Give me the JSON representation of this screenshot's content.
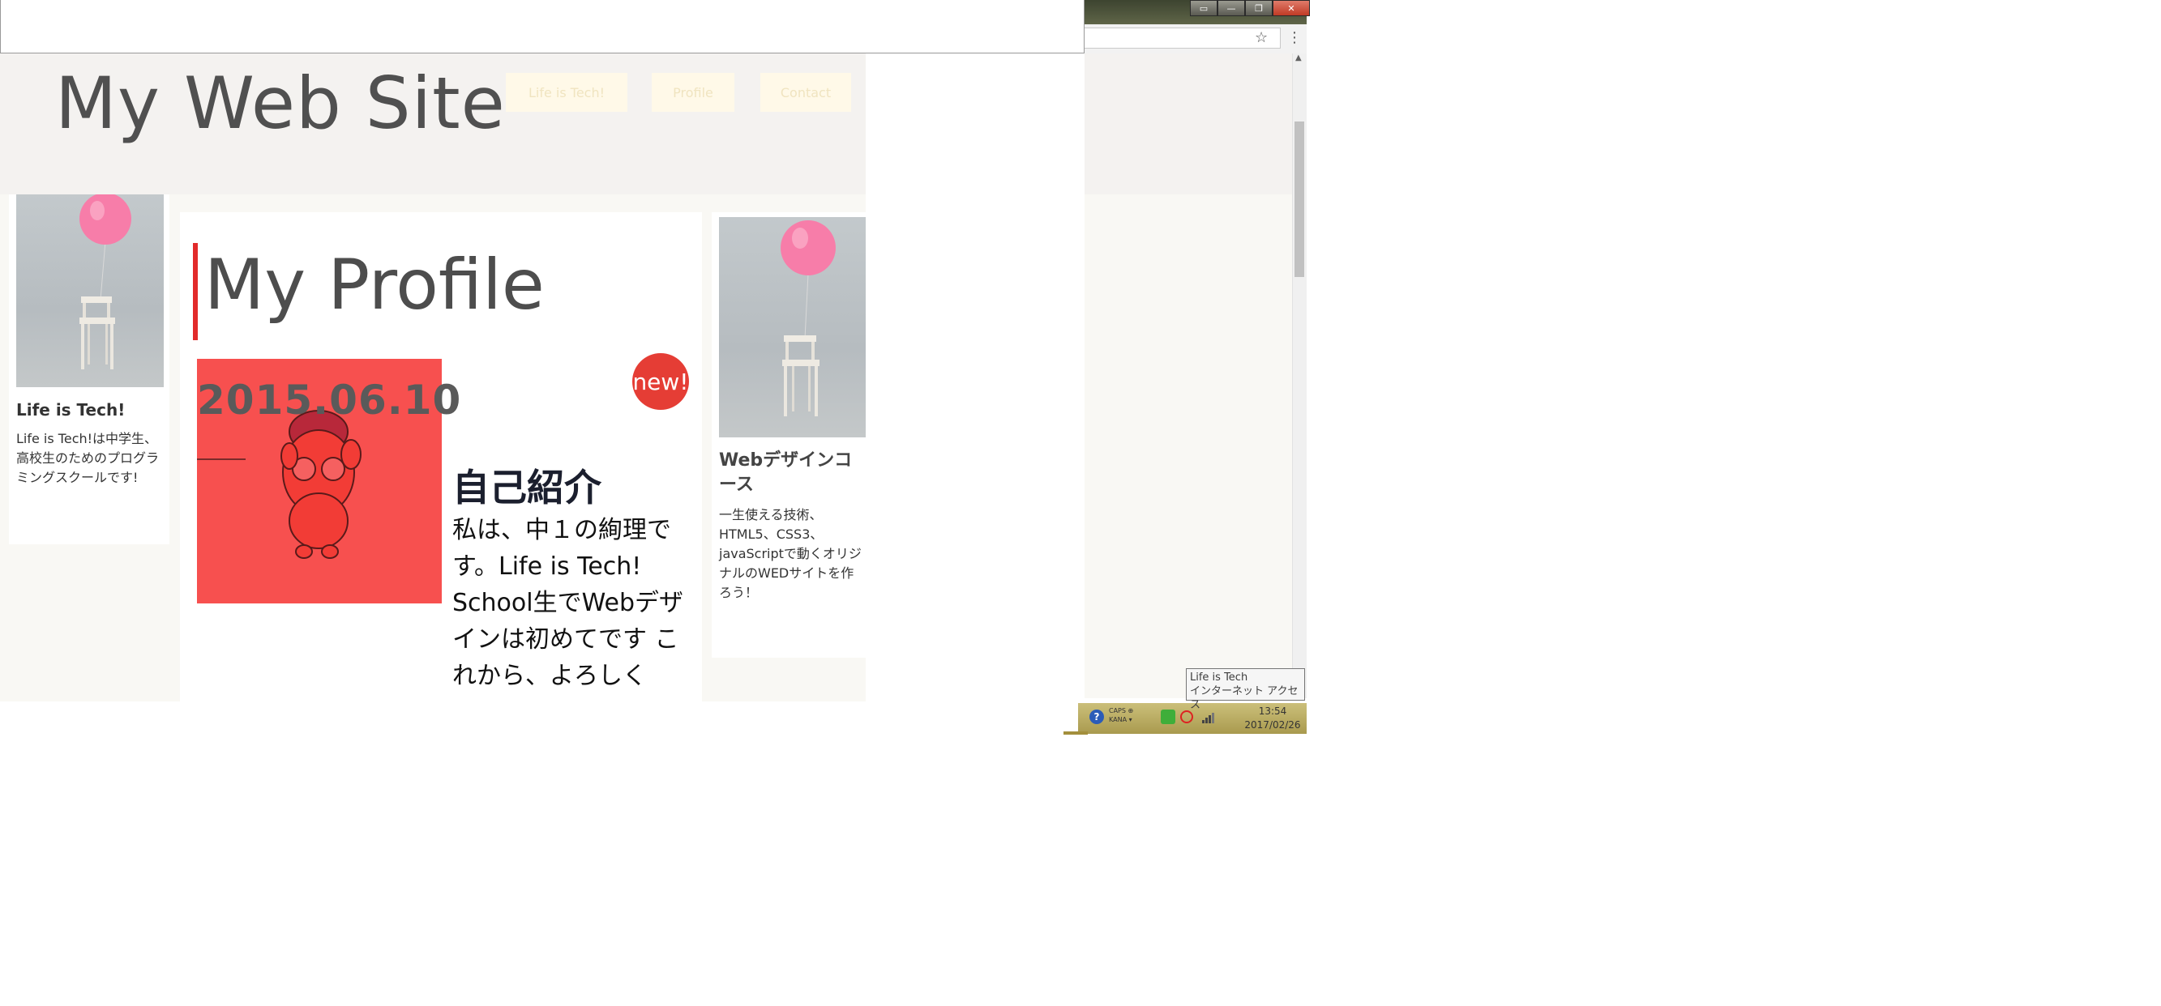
{
  "browser": {
    "window_buttons": [
      "▭",
      "—",
      "❐",
      "✕"
    ],
    "star_icon": "☆",
    "menu_icon": "⋮"
  },
  "taskbar": {
    "help_icon": "?",
    "tray_text_line1": "CAPS ⊕",
    "tray_text_line2": "KANA ▾",
    "time": "13:54",
    "date": "2017/02/26",
    "tooltip_line1": "Life is Tech",
    "tooltip_line2": "インターネット アクセス"
  },
  "site": {
    "title": "My Web Site",
    "nav": [
      "Life is Tech!",
      "Profile",
      "Contact"
    ]
  },
  "left_card": {
    "title": "Life is Tech!",
    "text": "Life is Tech!は中学生、高校生のためのプログラミングスクールです!"
  },
  "profile": {
    "heading": "My Profile",
    "date": "2015.06.10",
    "badge": "new!",
    "intro_title": "自己紹介",
    "intro_text": "私は、中１の絢理です。Life is Tech! School生でWebデザインは初めてです これから、よろしく"
  },
  "right_card": {
    "title": "Webデザインコース",
    "text": "一生使える技術、HTML5、CSS3、javaScriptで動くオリジナルのWEDサイトを作ろう！"
  },
  "colors": {
    "accent_red": "#e22b2b",
    "badge_red": "#e53d35",
    "header_bg": "#f4f2f0",
    "body_bg": "#f9f8f4"
  }
}
